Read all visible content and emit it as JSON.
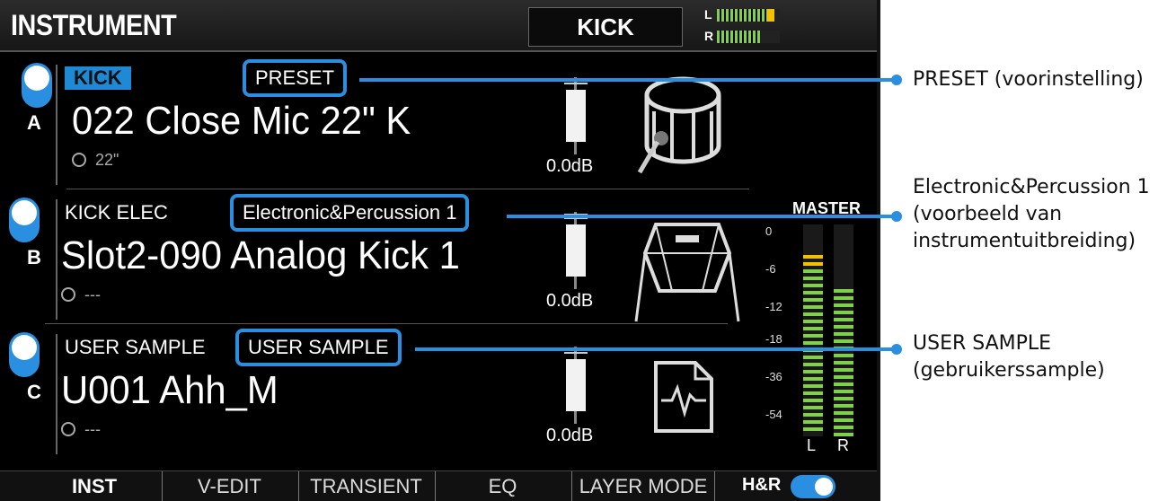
{
  "screen": {
    "title": "INSTRUMENT",
    "current_pad": "KICK",
    "meter_l_label": "L",
    "meter_r_label": "R",
    "meter_l_level": 0.82,
    "meter_r_level": 0.68
  },
  "layers": [
    {
      "letter": "A",
      "category": "KICK",
      "bank": "PRESET",
      "name": "022 Close Mic 22\" K",
      "sub": "22\"",
      "level": "0.0dB",
      "icon": "bass-drum-icon"
    },
    {
      "letter": "B",
      "category": "KICK ELEC",
      "bank": "Electronic&Percussion 1",
      "name": "Slot2-090 Analog Kick 1",
      "sub": "---",
      "level": "0.0dB",
      "icon": "electronic-pad-icon"
    },
    {
      "letter": "C",
      "category": "USER SAMPLE",
      "bank": "USER SAMPLE",
      "name": "U001 Ahh_M",
      "sub": "---",
      "level": "0.0dB",
      "icon": "waveform-file-icon"
    }
  ],
  "master": {
    "title": "MASTER",
    "scale": [
      "0",
      "-6",
      "-12",
      "-18",
      "-36",
      "-54"
    ],
    "left_label": "L",
    "right_label": "R"
  },
  "tabs": [
    "INST",
    "V-EDIT",
    "TRANSIENT",
    "EQ",
    "LAYER MODE"
  ],
  "hr": {
    "label": "H&R"
  },
  "callouts": [
    {
      "lines": [
        "PRESET (voorinstelling)"
      ]
    },
    {
      "lines": [
        "Electronic&Percussion 1",
        "(voorbeeld van",
        "instrumentuitbreiding)"
      ]
    },
    {
      "lines": [
        "USER SAMPLE",
        "(gebruikerssample)"
      ]
    }
  ],
  "colors": {
    "accent": "#2a8fe0",
    "meter_green": "#7fd14b",
    "meter_yellow": "#f5c000"
  }
}
